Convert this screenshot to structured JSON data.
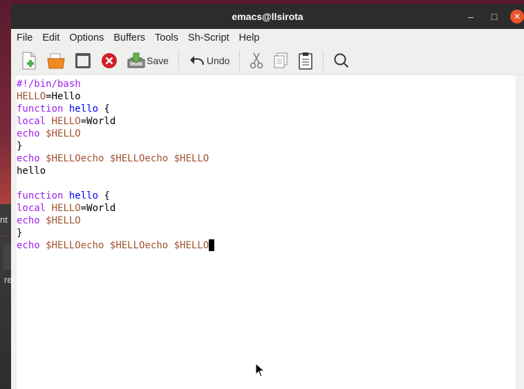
{
  "window": {
    "title": "emacs@llsirota"
  },
  "titlebar_controls": {
    "minimize": "–",
    "maximize": "□",
    "close": "✕"
  },
  "menu": {
    "items": [
      "File",
      "Edit",
      "Options",
      "Buffers",
      "Tools",
      "Sh-Script",
      "Help"
    ]
  },
  "toolbar": {
    "save_label": "Save",
    "undo_label": "Undo",
    "icons": [
      "new-file-icon",
      "open-folder-icon",
      "dired-icon",
      "close-buffer-icon",
      "save-icon",
      "undo-icon",
      "cut-icon",
      "copy-icon",
      "paste-icon",
      "search-icon"
    ]
  },
  "background": {
    "frag_text_1": "nt",
    "frag_text_2": "re"
  },
  "editor": {
    "lines": [
      [
        {
          "t": "#!/bin/bash",
          "c": "kw"
        }
      ],
      [
        {
          "t": "HELLO",
          "c": "var"
        },
        {
          "t": "=Hello",
          "c": ""
        }
      ],
      [
        {
          "t": "function",
          "c": "kw"
        },
        {
          "t": " ",
          "c": ""
        },
        {
          "t": "hello",
          "c": "fn"
        },
        {
          "t": " {",
          "c": ""
        }
      ],
      [
        {
          "t": "local",
          "c": "kw"
        },
        {
          "t": " ",
          "c": ""
        },
        {
          "t": "HELLO",
          "c": "var"
        },
        {
          "t": "=World",
          "c": ""
        }
      ],
      [
        {
          "t": "echo",
          "c": "kw"
        },
        {
          "t": " ",
          "c": ""
        },
        {
          "t": "$HELLO",
          "c": "var"
        }
      ],
      [
        {
          "t": "}",
          "c": ""
        }
      ],
      [
        {
          "t": "echo",
          "c": "kw"
        },
        {
          "t": " ",
          "c": ""
        },
        {
          "t": "$HELLOecho",
          "c": "var"
        },
        {
          "t": " ",
          "c": ""
        },
        {
          "t": "$HELLOecho",
          "c": "var"
        },
        {
          "t": " ",
          "c": ""
        },
        {
          "t": "$HELLO",
          "c": "var"
        }
      ],
      [
        {
          "t": "hello",
          "c": ""
        }
      ],
      [],
      [
        {
          "t": "function",
          "c": "kw"
        },
        {
          "t": " ",
          "c": ""
        },
        {
          "t": "hello",
          "c": "fn"
        },
        {
          "t": " {",
          "c": ""
        }
      ],
      [
        {
          "t": "local",
          "c": "kw"
        },
        {
          "t": " ",
          "c": ""
        },
        {
          "t": "HELLO",
          "c": "var"
        },
        {
          "t": "=World",
          "c": ""
        }
      ],
      [
        {
          "t": "echo",
          "c": "kw"
        },
        {
          "t": " ",
          "c": ""
        },
        {
          "t": "$HELLO",
          "c": "var"
        }
      ],
      [
        {
          "t": "}",
          "c": ""
        }
      ],
      [
        {
          "t": "echo",
          "c": "kw"
        },
        {
          "t": " ",
          "c": ""
        },
        {
          "t": "$HELLOecho",
          "c": "var"
        },
        {
          "t": " ",
          "c": ""
        },
        {
          "t": "$HELLOecho",
          "c": "var"
        },
        {
          "t": " ",
          "c": ""
        },
        {
          "t": "$HELLO",
          "c": "var"
        }
      ]
    ],
    "cursor_line": 13
  },
  "colors": {
    "keyword": "#a020f0",
    "function_name": "#0000ff",
    "variable": "#a0522d",
    "titlebar": "#2c2c2c",
    "close_button": "#e9542a"
  }
}
